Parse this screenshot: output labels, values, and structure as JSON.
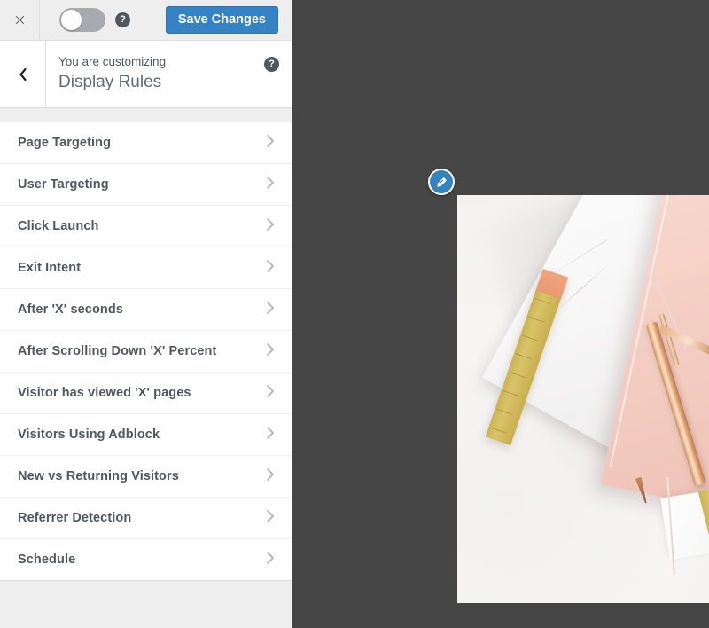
{
  "header": {
    "close_label": "×",
    "close_icon": "close-icon",
    "toggle_state": "off",
    "help_icon": "help-icon",
    "help_label": "?",
    "save_label": "Save Changes",
    "accent_color": "#3582c4"
  },
  "title_bar": {
    "back_icon": "chevron-left-icon",
    "eyebrow": "You are customizing",
    "title": "Display Rules",
    "help_label": "?"
  },
  "panels": [
    {
      "label": "Page Targeting"
    },
    {
      "label": "User Targeting"
    },
    {
      "label": "Click Launch"
    },
    {
      "label": "Exit Intent"
    },
    {
      "label": "After 'X' seconds"
    },
    {
      "label": "After Scrolling Down 'X' Percent"
    },
    {
      "label": "Visitor has viewed 'X' pages"
    },
    {
      "label": "Visitors Using Adblock"
    },
    {
      "label": "New vs Returning Visitors"
    },
    {
      "label": "Referrer Detection"
    },
    {
      "label": "Schedule"
    }
  ],
  "preview": {
    "background_color": "#464646",
    "edit_icon": "pencil-icon",
    "document_background": "#f3f2f1",
    "photo_description": "flat lay of pink and marble notebooks with a gold ruler and rose gold pen"
  }
}
